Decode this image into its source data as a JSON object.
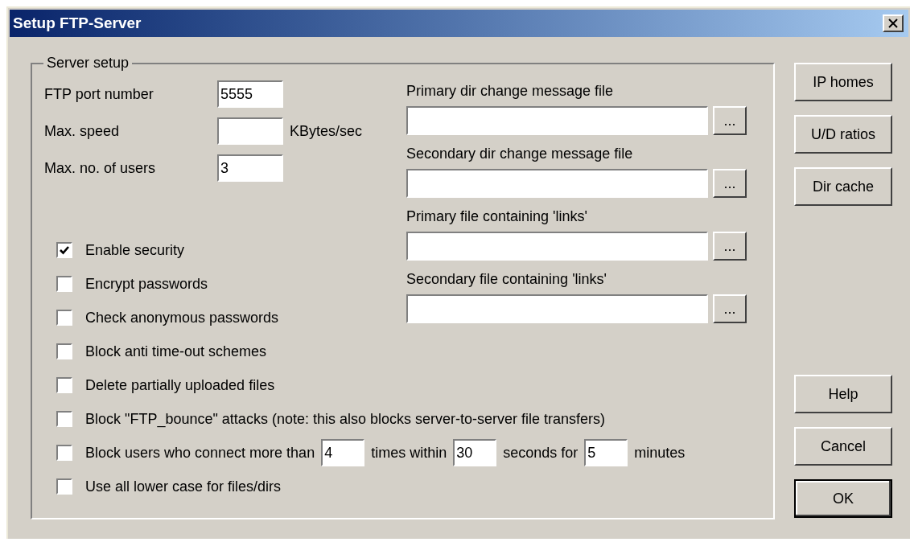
{
  "window": {
    "title": "Setup FTP-Server"
  },
  "server_setup": {
    "legend": "Server setup",
    "fields": [
      {
        "label": "FTP port number",
        "value": "5555"
      },
      {
        "label": "Max. speed",
        "unit": "KBytes/sec"
      },
      {
        "label": "Max. no. of users",
        "value": "3"
      }
    ],
    "files": [
      {
        "label": "Primary dir change message file",
        "browse": "..."
      },
      {
        "label": "Secondary dir change message file",
        "browse": "..."
      },
      {
        "label": "Primary file containing 'links'",
        "browse": "..."
      },
      {
        "label": "Secondary file containing 'links'",
        "browse": "..."
      }
    ],
    "options": [
      {
        "kind": "plain",
        "label": "Enable security",
        "checked": true
      },
      {
        "kind": "plain",
        "label": "Encrypt passwords",
        "checked": false
      },
      {
        "kind": "plain",
        "label": "Check anonymous passwords",
        "checked": false
      },
      {
        "kind": "plain",
        "label": "Block anti time-out schemes",
        "checked": false
      },
      {
        "kind": "plain",
        "label": "Delete partially uploaded files",
        "checked": false
      },
      {
        "kind": "plain",
        "label": "Block \"FTP_bounce\" attacks (note: this also blocks server-to-server file transfers)",
        "checked": false
      },
      {
        "kind": "with_fields",
        "checked": false,
        "parts": [
          {
            "kind": "text",
            "text": "Block users who connect more than"
          },
          {
            "kind": "field",
            "value": "4"
          },
          {
            "kind": "text",
            "text": "times within"
          },
          {
            "kind": "field",
            "value": "30"
          },
          {
            "kind": "text",
            "text": "seconds for"
          },
          {
            "kind": "field",
            "value": "5"
          },
          {
            "kind": "text",
            "text": "minutes"
          }
        ]
      },
      {
        "kind": "plain",
        "label": "Use all lower case for files/dirs",
        "checked": false
      }
    ]
  },
  "side_buttons": [
    {
      "label": "IP homes"
    },
    {
      "label": "U/D ratios"
    },
    {
      "label": "Dir cache"
    }
  ],
  "dialog_buttons": [
    {
      "label": "Help",
      "default": false
    },
    {
      "label": "Cancel",
      "default": false
    },
    {
      "label": "OK",
      "default": true
    }
  ]
}
